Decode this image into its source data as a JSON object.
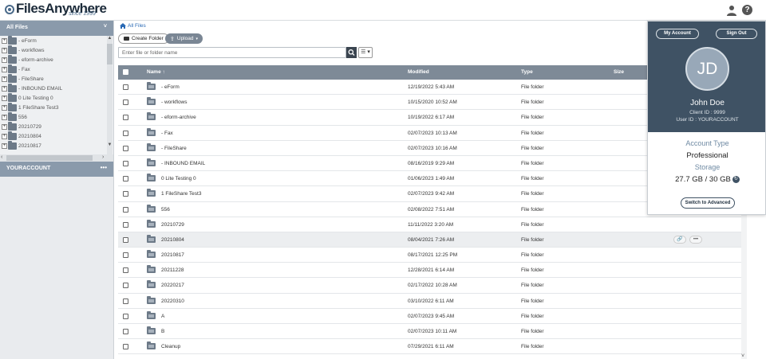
{
  "header": {
    "logo_text": "FilesAnywhere",
    "logo_tagline": "since 1999",
    "user_icon": "user-icon",
    "help_icon": "help-icon",
    "help_glyph": "?"
  },
  "sidebar": {
    "title": "All Files",
    "collapse_glyph": "˅",
    "tree": [
      {
        "label": "- eForm"
      },
      {
        "label": "- workflows"
      },
      {
        "label": "- eform-archive"
      },
      {
        "label": "- Fax"
      },
      {
        "label": "- FileShare"
      },
      {
        "label": "- INBOUND EMAIL"
      },
      {
        "label": "0 Lite Testing 0"
      },
      {
        "label": "1 FileShare Test3"
      },
      {
        "label": "556"
      },
      {
        "label": "20210729"
      },
      {
        "label": "20210804"
      },
      {
        "label": "20210817"
      }
    ],
    "account_section": "YOURACCOUNT",
    "account_more": "•••"
  },
  "main": {
    "breadcrumb": "All Files",
    "create_folder": "Create Folder",
    "upload": "Upload",
    "search_placeholder": "Enter file or folder name",
    "view_glyph": "☰ ▾",
    "columns": {
      "name": "Name ↑",
      "modified": "Modified",
      "type": "Type",
      "size": "Size"
    },
    "rows": [
      {
        "name": "- eForm",
        "modified": "12/19/2022 5:43 AM",
        "type": "File folder",
        "size": ""
      },
      {
        "name": "- workflows",
        "modified": "10/15/2020 10:52 AM",
        "type": "File folder",
        "size": ""
      },
      {
        "name": "- eform-archive",
        "modified": "10/19/2022 6:17 AM",
        "type": "File folder",
        "size": ""
      },
      {
        "name": "- Fax",
        "modified": "02/07/2023 10:13 AM",
        "type": "File folder",
        "size": ""
      },
      {
        "name": "- FileShare",
        "modified": "02/07/2023 10:16 AM",
        "type": "File folder",
        "size": ""
      },
      {
        "name": "- INBOUND EMAIL",
        "modified": "08/16/2019 9:29 AM",
        "type": "File folder",
        "size": ""
      },
      {
        "name": "0 Lite Testing 0",
        "modified": "01/06/2023 1:49 AM",
        "type": "File folder",
        "size": ""
      },
      {
        "name": "1 FileShare Test3",
        "modified": "02/07/2023 9:42 AM",
        "type": "File folder",
        "size": ""
      },
      {
        "name": "556",
        "modified": "02/08/2022 7:51 AM",
        "type": "File folder",
        "size": ""
      },
      {
        "name": "20210729",
        "modified": "11/11/2022 3:20 AM",
        "type": "File folder",
        "size": ""
      },
      {
        "name": "20210804",
        "modified": "08/04/2021 7:26 AM",
        "type": "File folder",
        "size": "",
        "highlighted": true
      },
      {
        "name": "20210817",
        "modified": "08/17/2021 12:25 PM",
        "type": "File folder",
        "size": ""
      },
      {
        "name": "20211228",
        "modified": "12/28/2021 6:14 AM",
        "type": "File folder",
        "size": ""
      },
      {
        "name": "20220217",
        "modified": "02/17/2022 10:28 AM",
        "type": "File folder",
        "size": ""
      },
      {
        "name": "20220310",
        "modified": "03/10/2022 6:11 AM",
        "type": "File folder",
        "size": ""
      },
      {
        "name": "A",
        "modified": "02/07/2023 9:45 AM",
        "type": "File folder",
        "size": ""
      },
      {
        "name": "B",
        "modified": "02/07/2023 10:11 AM",
        "type": "File folder",
        "size": ""
      },
      {
        "name": "Cleanup",
        "modified": "07/29/2021 6:11 AM",
        "type": "File folder",
        "size": ""
      }
    ],
    "row_link_glyph": "🔗",
    "row_more_glyph": "•••"
  },
  "account_popup": {
    "my_account": "My Account",
    "sign_out": "Sign Out",
    "initials": "JD",
    "name": "John Doe",
    "client_id": "Client ID : 9999",
    "user_id": "User ID : YOURACCOUNT",
    "account_type_label": "Account Type",
    "account_type": "Professional",
    "storage_label": "Storage",
    "storage_value": "27.7 GB / 30 GB",
    "switch_button": "Switch to Advanced"
  },
  "colors": {
    "header_bar": "#8a9aab",
    "table_header": "#7e8a97",
    "popup_dark": "#3f5264",
    "link": "#2a6ab5"
  }
}
